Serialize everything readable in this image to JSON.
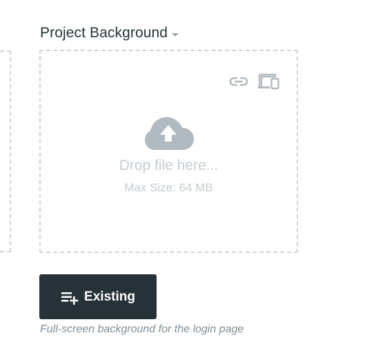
{
  "field": {
    "label": "Project Background",
    "helper_text": "Full-screen background for the login page"
  },
  "dropzone": {
    "prompt": "Drop file here...",
    "max_size": "Max Size: 64 MB"
  },
  "icons": {
    "link": "link-icon",
    "devices": "devices-icon",
    "upload": "cloud-upload-icon",
    "add": "playlist-add-icon",
    "caret": "caret-down-icon"
  },
  "actions": {
    "existing_label": "Existing"
  },
  "colors": {
    "dark": "#263238",
    "dashed_border": "#cdd3d8",
    "muted_text": "#c5ccd1",
    "icon_gray": "#b0bac0",
    "helper_text": "#7f8c95"
  }
}
